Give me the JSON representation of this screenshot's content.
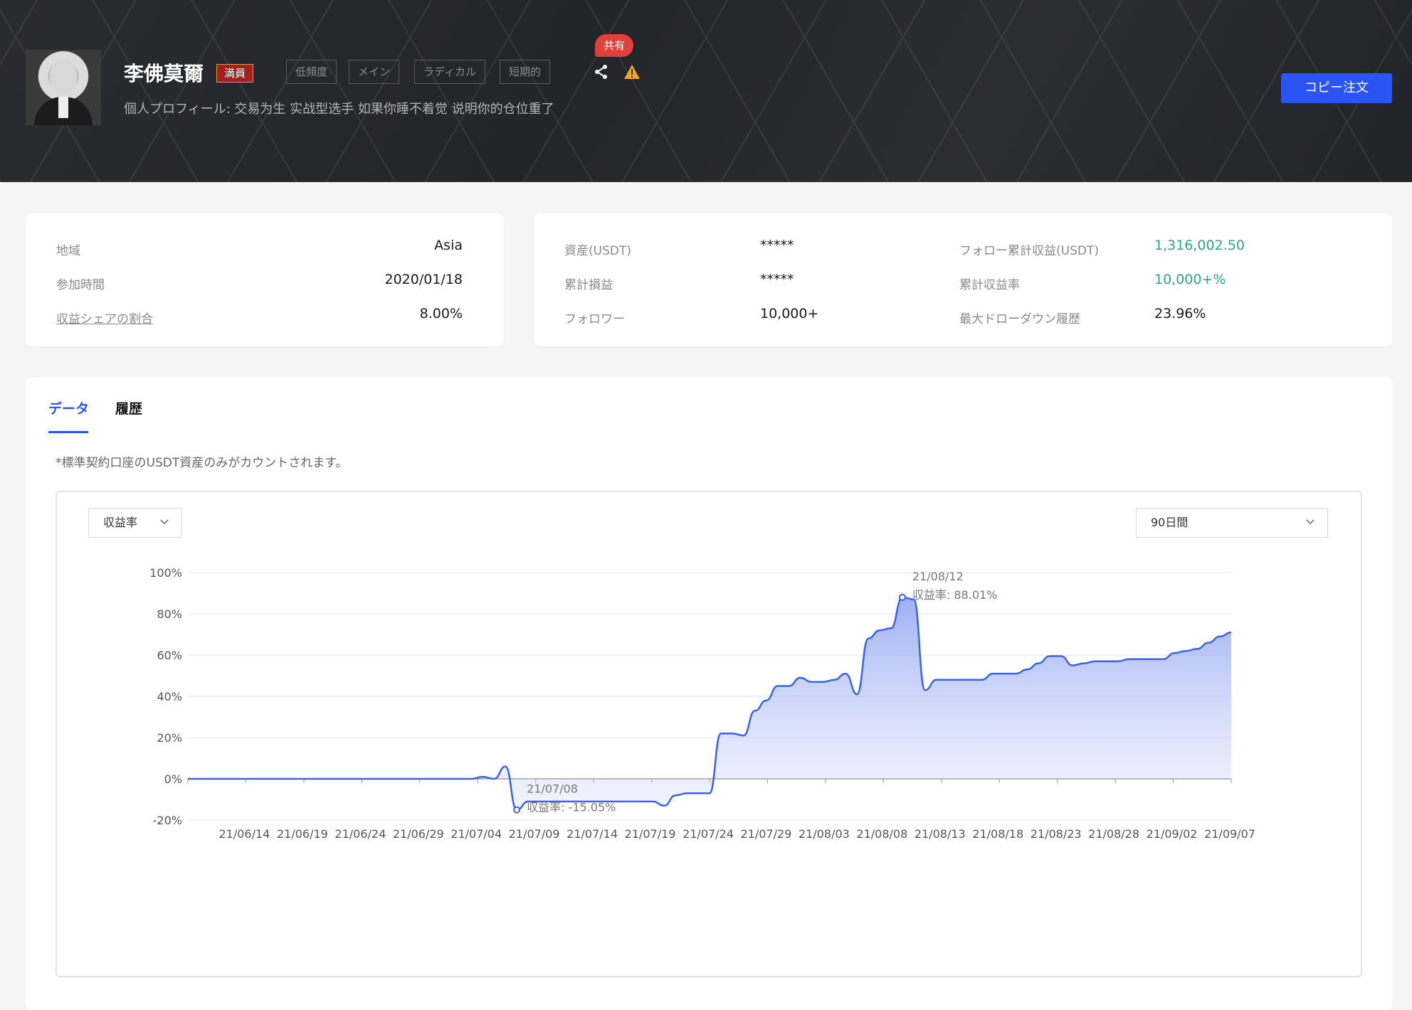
{
  "header": {
    "name": "李佛莫爾",
    "member_badge": "満員",
    "tags": [
      "低頻度",
      "メイン",
      "ラディカル",
      "短期的"
    ],
    "bio": "個人プロフィール: 交易为生 实战型选手 如果你睡不着觉 说明你的仓位重了",
    "share_label": "共有",
    "copy_button": "コピー注文"
  },
  "profile": {
    "region_label": "地域",
    "region_value": "Asia",
    "join_label": "参加時間",
    "join_value": "2020/01/18",
    "share_ratio_label": "収益シェアの割合",
    "share_ratio_value": "8.00%"
  },
  "stats": {
    "assets_label": "資産(USDT)",
    "assets_value": "*****",
    "pnl_label": "累計損益",
    "pnl_value": "*****",
    "followers_label": "フォロワー",
    "followers_value": "10,000+",
    "follow_profit_label": "フォロー累計収益(USDT)",
    "follow_profit_value": "1,316,002.50",
    "total_return_label": "累計収益率",
    "total_return_value": "10,000+%",
    "max_drawdown_label": "最大ドローダウン履歴",
    "max_drawdown_value": "23.96%"
  },
  "tabs": {
    "data": "データ",
    "history": "履歴"
  },
  "note": "*標準契約口座のUSDT資産のみがカウントされます。",
  "filters": {
    "metric": "収益率",
    "period": "90日間"
  },
  "colors": {
    "accent": "#2b54f5",
    "positive": "#2ea87f",
    "danger": "#e0403a",
    "line": "#3b63e6"
  },
  "chart_data": {
    "type": "area",
    "xlabel": "",
    "ylabel": "",
    "x_ticks": [
      "21/06/14",
      "21/06/19",
      "21/06/24",
      "21/06/29",
      "21/07/04",
      "21/07/09",
      "21/07/14",
      "21/07/19",
      "21/07/24",
      "21/07/29",
      "21/08/03",
      "21/08/08",
      "21/08/13",
      "21/08/18",
      "21/08/23",
      "21/08/28",
      "21/09/02",
      "21/09/07"
    ],
    "y_ticks": [
      "100%",
      "80%",
      "60%",
      "40%",
      "20%",
      "0%",
      "-20%"
    ],
    "ylim": [
      -20,
      100
    ],
    "series": [
      {
        "values": [
          0,
          0,
          0,
          0,
          0,
          0,
          0,
          0,
          0,
          0,
          0,
          0,
          0,
          0,
          0,
          0,
          0,
          0,
          0,
          0,
          0,
          0,
          0,
          0,
          0,
          0,
          1,
          0,
          6,
          -15.05,
          -11,
          -11,
          -11,
          -11,
          -11,
          -11,
          -11,
          -11,
          -11,
          -11,
          -11,
          -11,
          -13,
          -8,
          -7,
          -7,
          -7,
          22,
          22,
          21,
          33,
          38,
          45,
          45,
          49,
          47,
          47,
          48,
          51,
          41,
          68,
          72,
          73,
          88.01,
          87,
          43,
          48,
          48,
          48,
          48,
          48,
          51,
          51,
          51,
          53,
          56,
          59.5,
          59.5,
          55,
          56,
          57,
          57,
          57,
          58,
          58,
          58,
          58,
          61,
          62,
          63,
          66,
          69,
          71
        ]
      }
    ],
    "annotations": [
      {
        "date": "21/07/08",
        "text": "収益率: -15.05%"
      },
      {
        "date": "21/08/12",
        "text": "収益率: 88.01%"
      }
    ]
  }
}
